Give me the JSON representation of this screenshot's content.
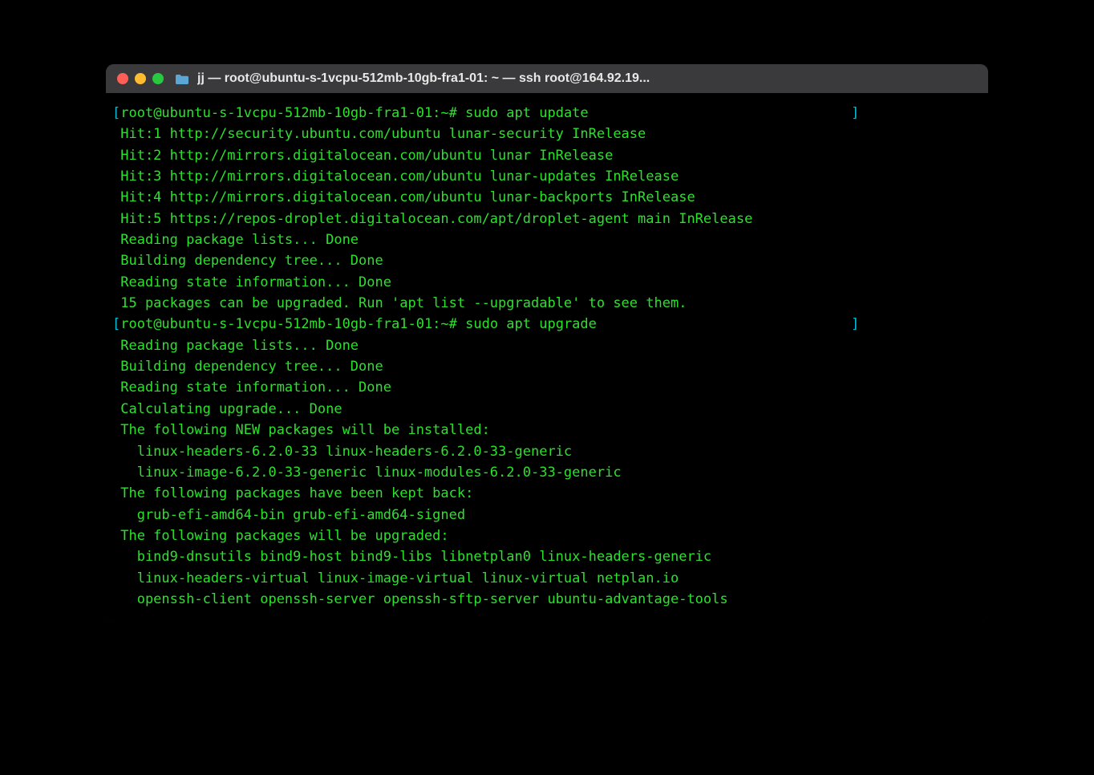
{
  "window": {
    "title": "jj — root@ubuntu-s-1vcpu-512mb-10gb-fra1-01: ~ — ssh root@164.92.19..."
  },
  "terminal": {
    "lines": [
      {
        "type": "prompt",
        "bracket_open": "[",
        "prompt": "root@ubuntu-s-1vcpu-512mb-10gb-fra1-01:~#",
        "command": " sudo apt update",
        "bracket_close": "]"
      },
      {
        "type": "output",
        "text": " Hit:1 http://security.ubuntu.com/ubuntu lunar-security InRelease"
      },
      {
        "type": "output",
        "text": " Hit:2 http://mirrors.digitalocean.com/ubuntu lunar InRelease"
      },
      {
        "type": "output",
        "text": " Hit:3 http://mirrors.digitalocean.com/ubuntu lunar-updates InRelease"
      },
      {
        "type": "output",
        "text": " Hit:4 http://mirrors.digitalocean.com/ubuntu lunar-backports InRelease"
      },
      {
        "type": "output",
        "text": " Hit:5 https://repos-droplet.digitalocean.com/apt/droplet-agent main InRelease"
      },
      {
        "type": "output",
        "text": " Reading package lists... Done"
      },
      {
        "type": "output",
        "text": " Building dependency tree... Done"
      },
      {
        "type": "output",
        "text": " Reading state information... Done"
      },
      {
        "type": "output",
        "text": " 15 packages can be upgraded. Run 'apt list --upgradable' to see them."
      },
      {
        "type": "prompt",
        "bracket_open": "[",
        "prompt": "root@ubuntu-s-1vcpu-512mb-10gb-fra1-01:~#",
        "command": " sudo apt upgrade",
        "bracket_close": "]"
      },
      {
        "type": "output",
        "text": " Reading package lists... Done"
      },
      {
        "type": "output",
        "text": " Building dependency tree... Done"
      },
      {
        "type": "output",
        "text": " Reading state information... Done"
      },
      {
        "type": "output",
        "text": " Calculating upgrade... Done"
      },
      {
        "type": "output",
        "text": " The following NEW packages will be installed:"
      },
      {
        "type": "output",
        "text": "   linux-headers-6.2.0-33 linux-headers-6.2.0-33-generic"
      },
      {
        "type": "output",
        "text": "   linux-image-6.2.0-33-generic linux-modules-6.2.0-33-generic"
      },
      {
        "type": "output",
        "text": " The following packages have been kept back:"
      },
      {
        "type": "output",
        "text": "   grub-efi-amd64-bin grub-efi-amd64-signed"
      },
      {
        "type": "output",
        "text": " The following packages will be upgraded:"
      },
      {
        "type": "output",
        "text": "   bind9-dnsutils bind9-host bind9-libs libnetplan0 linux-headers-generic"
      },
      {
        "type": "output",
        "text": "   linux-headers-virtual linux-image-virtual linux-virtual netplan.io"
      },
      {
        "type": "output",
        "text": "   openssh-client openssh-server openssh-sftp-server ubuntu-advantage-tools"
      }
    ]
  }
}
